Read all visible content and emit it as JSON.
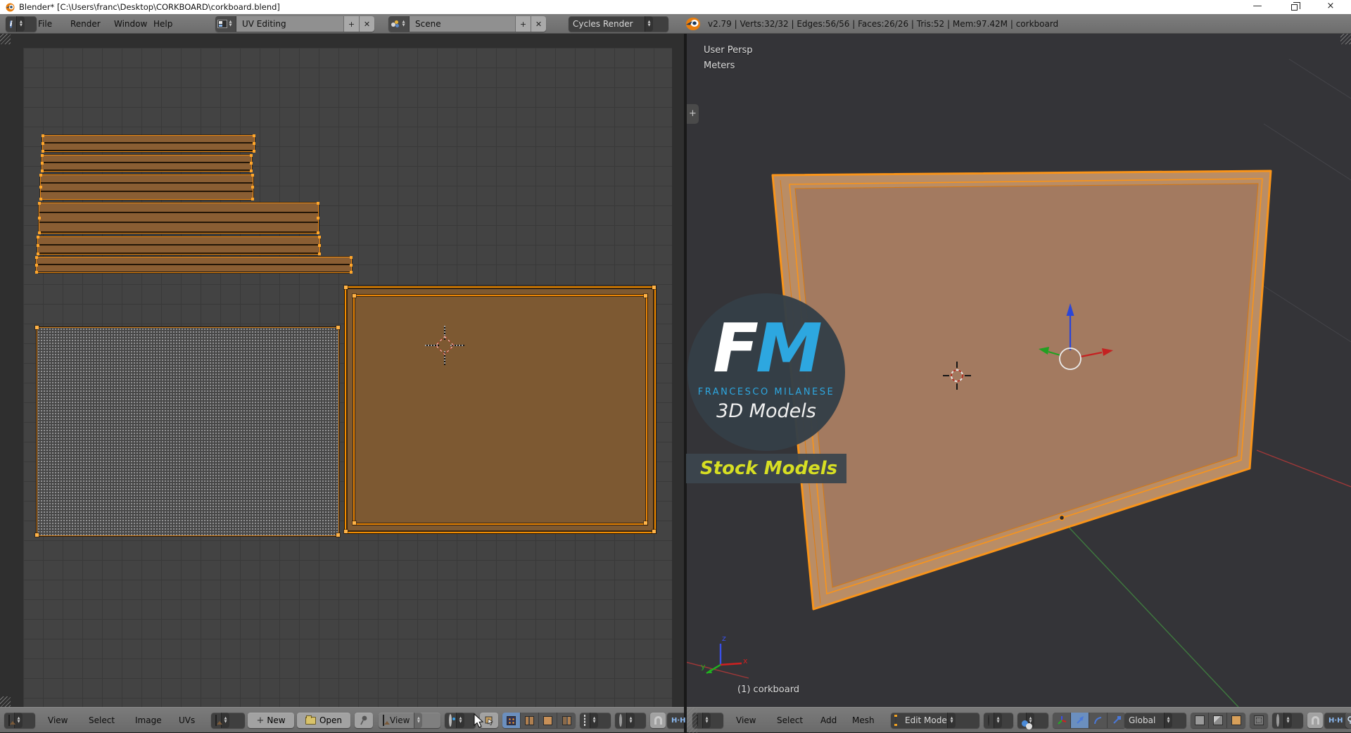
{
  "window": {
    "title": "Blender* [C:\\Users\\franc\\Desktop\\CORKBOARD\\corkboard.blend]",
    "minimize_glyph": "—",
    "close_glyph": "×"
  },
  "topbar": {
    "menus": [
      "File",
      "Render",
      "Window",
      "Help"
    ],
    "layout_name": "UV Editing",
    "layout_add": "+",
    "layout_close": "✕",
    "scene_name": "Scene",
    "scene_add": "+",
    "scene_close": "✕",
    "engine": "Cycles Render",
    "stats": "v2.79 | Verts:32/32 | Edges:56/56 | Faces:26/26 | Tris:52 | Mem:97.42M | corkboard"
  },
  "uv_header": {
    "menus": [
      "View",
      "Select",
      "Image",
      "UVs"
    ],
    "new_label": "New",
    "new_plus": "+",
    "open_label": "Open",
    "view_label": "View"
  },
  "v3d_header": {
    "menus": [
      "View",
      "Select",
      "Add",
      "Mesh"
    ],
    "mode": "Edit Mode",
    "orientation": "Global"
  },
  "viewport": {
    "persp_label": "User Persp",
    "unit_label": "Meters",
    "object_label": "(1) corkboard",
    "plus_tab": "+",
    "axis_x": "x",
    "axis_y": "y",
    "axis_z": "z"
  },
  "watermark": {
    "initial_f": "F",
    "initial_m": "M",
    "name": "FRANCESCO MILANESE",
    "line2": "3D Models",
    "banner": "Stock Models"
  },
  "colors": {
    "accent_orange": "#f08c00",
    "selection_blue": "#6b8fbf",
    "logo_blue": "#2da7e0",
    "banner_yellow": "#d7df23",
    "face_brown": "#a37a60",
    "uv_fill": "#8a5e33"
  }
}
